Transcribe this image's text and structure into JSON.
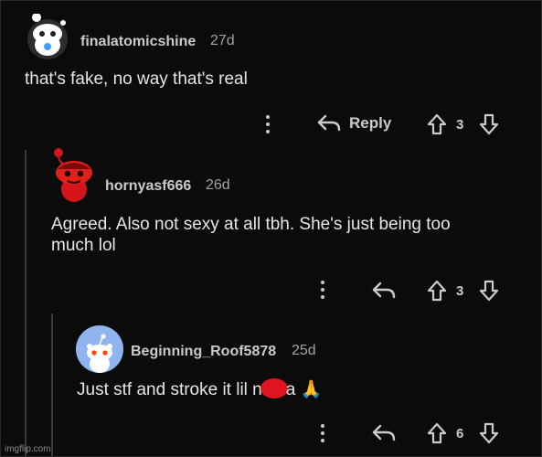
{
  "comments": [
    {
      "username": "finalatomicshine",
      "age": "27d",
      "body": "that's fake, no way that's real",
      "reply_label": "Reply",
      "votes": "3"
    },
    {
      "username": "hornyasf666",
      "age": "26d",
      "body_line1": "Agreed. Also not sexy at all tbh. She's just being too",
      "body_line2": "much lol",
      "votes": "3"
    },
    {
      "username": "Beginning_Roof5878",
      "age": "25d",
      "body_before": "Just stf and stroke it lil n",
      "body_after": "a 🙏",
      "votes": "6"
    }
  ],
  "watermark": "imgflip.com",
  "colors": {
    "background": "#0b0b0b",
    "text": "#e4e6e8",
    "muted": "#9ea3a6",
    "avatar2": "#d4161c",
    "avatar3": "#8fb4f0",
    "redaction": "#e0141e"
  },
  "icons": [
    "more-options-icon",
    "reply-arrow-icon",
    "upvote-icon",
    "downvote-icon"
  ]
}
